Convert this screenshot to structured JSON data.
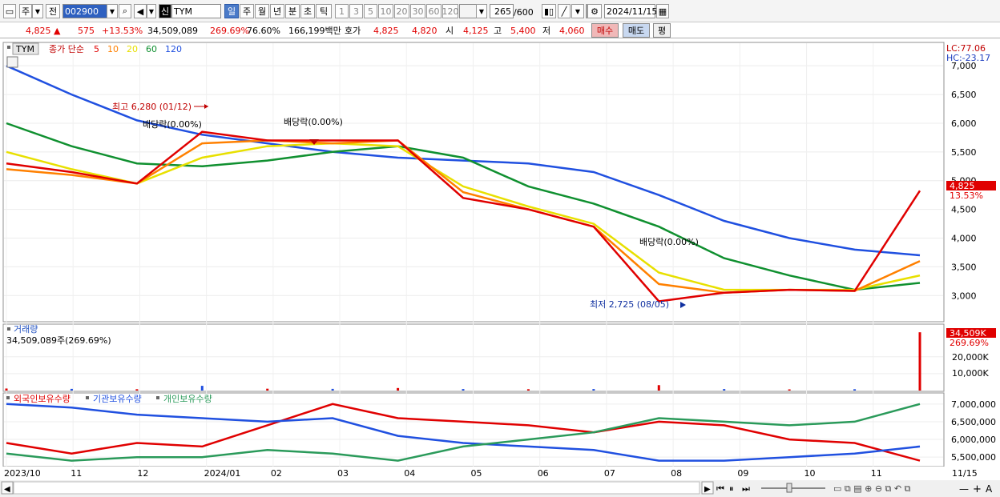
{
  "toolbar": {
    "type_label": "주",
    "prefix_label": "전",
    "code": "002900",
    "market_badge": "신",
    "stock_name": "TYM",
    "periods": [
      "일",
      "주",
      "월",
      "년",
      "분",
      "초",
      "틱"
    ],
    "intervals": [
      "1",
      "3",
      "5",
      "10",
      "20",
      "30",
      "60",
      "120"
    ],
    "count": "265",
    "count_total": "/600",
    "date": "2024/11/15"
  },
  "quote": {
    "price": "4,825",
    "arrow": "▲",
    "change": "575",
    "change_pct": "+13.53%",
    "volume": "34,509,089",
    "volume_ratio": "269.69%",
    "rate": "76.60%",
    "amount": "166,199백만",
    "hoga_label": "호가",
    "hoga1": "4,825",
    "hoga2": "4,820",
    "open_label": "시",
    "open": "4,125",
    "high_label": "고",
    "high": "5,400",
    "low_label": "저",
    "low": "4,060",
    "buy_label": "매수",
    "sell_label": "매도",
    "avg_label": "평"
  },
  "price_panel": {
    "tag": "TYM",
    "legend_label": "종가 단순",
    "ma": [
      {
        "p": "5",
        "color": "#e00000"
      },
      {
        "p": "10",
        "color": "#ff8000"
      },
      {
        "p": "20",
        "color": "#e8e000"
      },
      {
        "p": "60",
        "color": "#109030"
      },
      {
        "p": "120",
        "color": "#2050e0"
      }
    ],
    "lc": "LC:77.06",
    "hc": "HC:-23.17",
    "ticks": [
      "7,000",
      "6,500",
      "6,000",
      "5,500",
      "5,000",
      "4,500",
      "4,000",
      "3,500",
      "3,000"
    ],
    "current_price": "4,825",
    "current_pct": "13.53%",
    "annotations": {
      "high": "최고 6,280 (01/12)",
      "low": "최저 2,725 (08/05)",
      "div1": "배당락(0.00%)",
      "div2": "배당락(0.00%)",
      "div3": "배당락(0.00%)"
    }
  },
  "volume_panel": {
    "title": "거래량",
    "info": "34,509,089주(269.69%)",
    "ticks": [
      "20,000K",
      "10,000K"
    ],
    "current": "34,509K",
    "current_pct": "269.69%"
  },
  "holding_panel": {
    "legend": [
      {
        "name": "외국인보유수량",
        "color": "#e00000"
      },
      {
        "name": "기관보유수량",
        "color": "#2050e0"
      },
      {
        "name": "개인보유수량",
        "color": "#2a9a5a"
      }
    ],
    "ticks": [
      "7,000,000",
      "6,500,000",
      "6,000,000",
      "5,500,000"
    ]
  },
  "x_axis": {
    "labels": [
      "2023/10",
      "11",
      "12",
      "2024/01",
      "02",
      "03",
      "04",
      "05",
      "06",
      "07",
      "08",
      "09",
      "10",
      "11"
    ],
    "right_label": "11/15"
  },
  "chart_data": {
    "type": "line",
    "title": "",
    "x": [
      "2023/10",
      "11",
      "12",
      "2024/01",
      "02",
      "03",
      "04",
      "05",
      "06",
      "07",
      "08",
      "09",
      "10",
      "11",
      "11/15"
    ],
    "ylim": [
      2600,
      7100
    ],
    "series": [
      {
        "name": "",
        "values": [
          5300,
          5150,
          4950,
          5850,
          5700,
          5700,
          5700,
          4700,
          4500,
          4200,
          2900,
          3050,
          3100,
          3080,
          4825
        ]
      },
      {
        "name": "",
        "values": [
          5200,
          5100,
          4950,
          5650,
          5700,
          5650,
          5700,
          4800,
          4500,
          4200,
          3200,
          3050,
          3100,
          3080,
          3600
        ]
      },
      {
        "name": "",
        "values": [
          5500,
          5200,
          4950,
          5400,
          5600,
          5650,
          5600,
          4900,
          4550,
          4250,
          3400,
          3100,
          3100,
          3100,
          3350
        ]
      },
      {
        "name": "",
        "values": [
          6000,
          5600,
          5300,
          5250,
          5350,
          5500,
          5600,
          5400,
          4900,
          4600,
          4200,
          3650,
          3350,
          3100,
          3220
        ]
      },
      {
        "name": "",
        "values": [
          7000,
          6500,
          6050,
          5800,
          5650,
          5500,
          5400,
          5350,
          5300,
          5150,
          4750,
          4300,
          4000,
          3800,
          3700
        ]
      }
    ],
    "volume_values": [
      1.2,
      1.0,
      0.8,
      2.8,
      1.1,
      1.0,
      1.5,
      0.9,
      0.8,
      0.9,
      3.2,
      0.9,
      0.7,
      0.8,
      34.5
    ],
    "foreign": [
      5.9,
      5.6,
      5.9,
      5.8,
      6.4,
      7.0,
      6.6,
      6.5,
      6.4,
      6.2,
      6.5,
      6.4,
      6.0,
      5.9,
      5.4
    ],
    "institution": [
      7.0,
      6.9,
      6.7,
      6.6,
      6.5,
      6.6,
      6.1,
      5.9,
      5.8,
      5.7,
      5.4,
      5.4,
      5.5,
      5.6,
      5.8
    ],
    "individual": [
      5.6,
      5.4,
      5.5,
      5.5,
      5.7,
      5.6,
      5.4,
      5.8,
      6.0,
      6.2,
      6.6,
      6.5,
      6.4,
      6.5,
      7.0
    ]
  }
}
